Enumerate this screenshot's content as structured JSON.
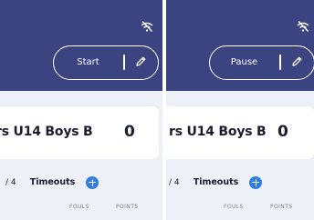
{
  "panels": [
    {
      "control_button_label": "Start",
      "team_name": "rs U14 Boys B",
      "team_score": "0",
      "timeout_count": "/ 4",
      "timeouts_label": "Timeouts",
      "col_fouls": "FOULS",
      "col_points": "POINTS"
    },
    {
      "control_button_label": "Pause",
      "team_name": "rs U14 Boys B",
      "team_score": "0",
      "timeout_count": "/ 4",
      "timeouts_label": "Timeouts",
      "col_fouls": "FOULS",
      "col_points": "POINTS"
    }
  ],
  "icons": {
    "settings": "wifi-off-icon",
    "edit": "pencil-icon",
    "add_timeout": "plus-circle-icon"
  },
  "colors": {
    "header_bg": "#3b4380",
    "accent_blue": "#2f7de1",
    "body_bg": "#edf0f6",
    "text_dark": "#1a1d2e",
    "text_muted": "#7c8497"
  }
}
